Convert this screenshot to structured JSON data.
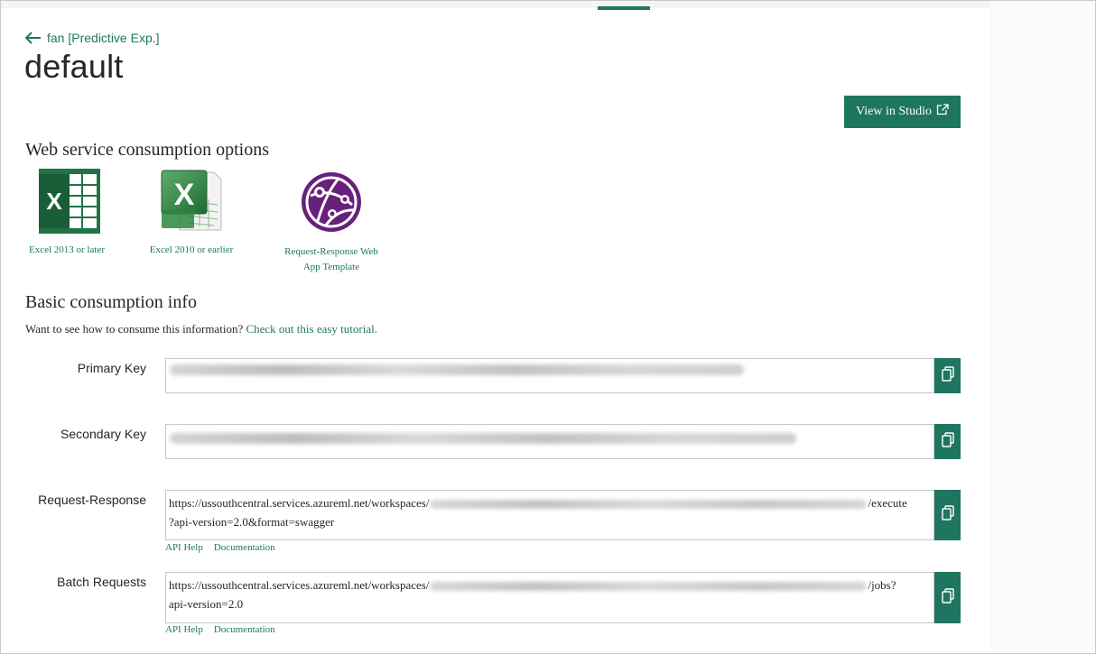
{
  "header": {
    "back_link": "fan [Predictive Exp.]",
    "title": "default",
    "view_studio_label": "View in Studio"
  },
  "consumption_options": {
    "heading": "Web service consumption options",
    "items": [
      {
        "label": "Excel 2013 or later",
        "icon": "excel-2013-icon"
      },
      {
        "label": "Excel 2010 or earlier",
        "icon": "excel-2010-icon"
      },
      {
        "label_line1": "Request-Response Web",
        "label_line2": "App Template",
        "icon": "web-app-template-icon"
      }
    ]
  },
  "basic_info": {
    "heading": "Basic consumption info",
    "intro_text": "Want to see how to consume this information? ",
    "intro_link": "Check out this easy tutorial.",
    "fields": [
      {
        "label": "Primary Key"
      },
      {
        "label": "Secondary Key"
      },
      {
        "label": "Request-Response",
        "url_prefix": "https://ussouthcentral.services.azureml.net/workspaces/",
        "url_suffix": "/execute",
        "url_line2": "?api-version=2.0&format=swagger",
        "link_help": "API Help",
        "link_docs": "Documentation"
      },
      {
        "label": "Batch Requests",
        "url_prefix": "https://ussouthcentral.services.azureml.net/workspaces/",
        "url_suffix": "/jobs?",
        "url_line2": "api-version=2.0",
        "link_help": "API Help",
        "link_docs": "Documentation"
      }
    ]
  },
  "colors": {
    "accent": "#1e7660",
    "excel_green": "#217346",
    "web_app_purple": "#68217a"
  }
}
